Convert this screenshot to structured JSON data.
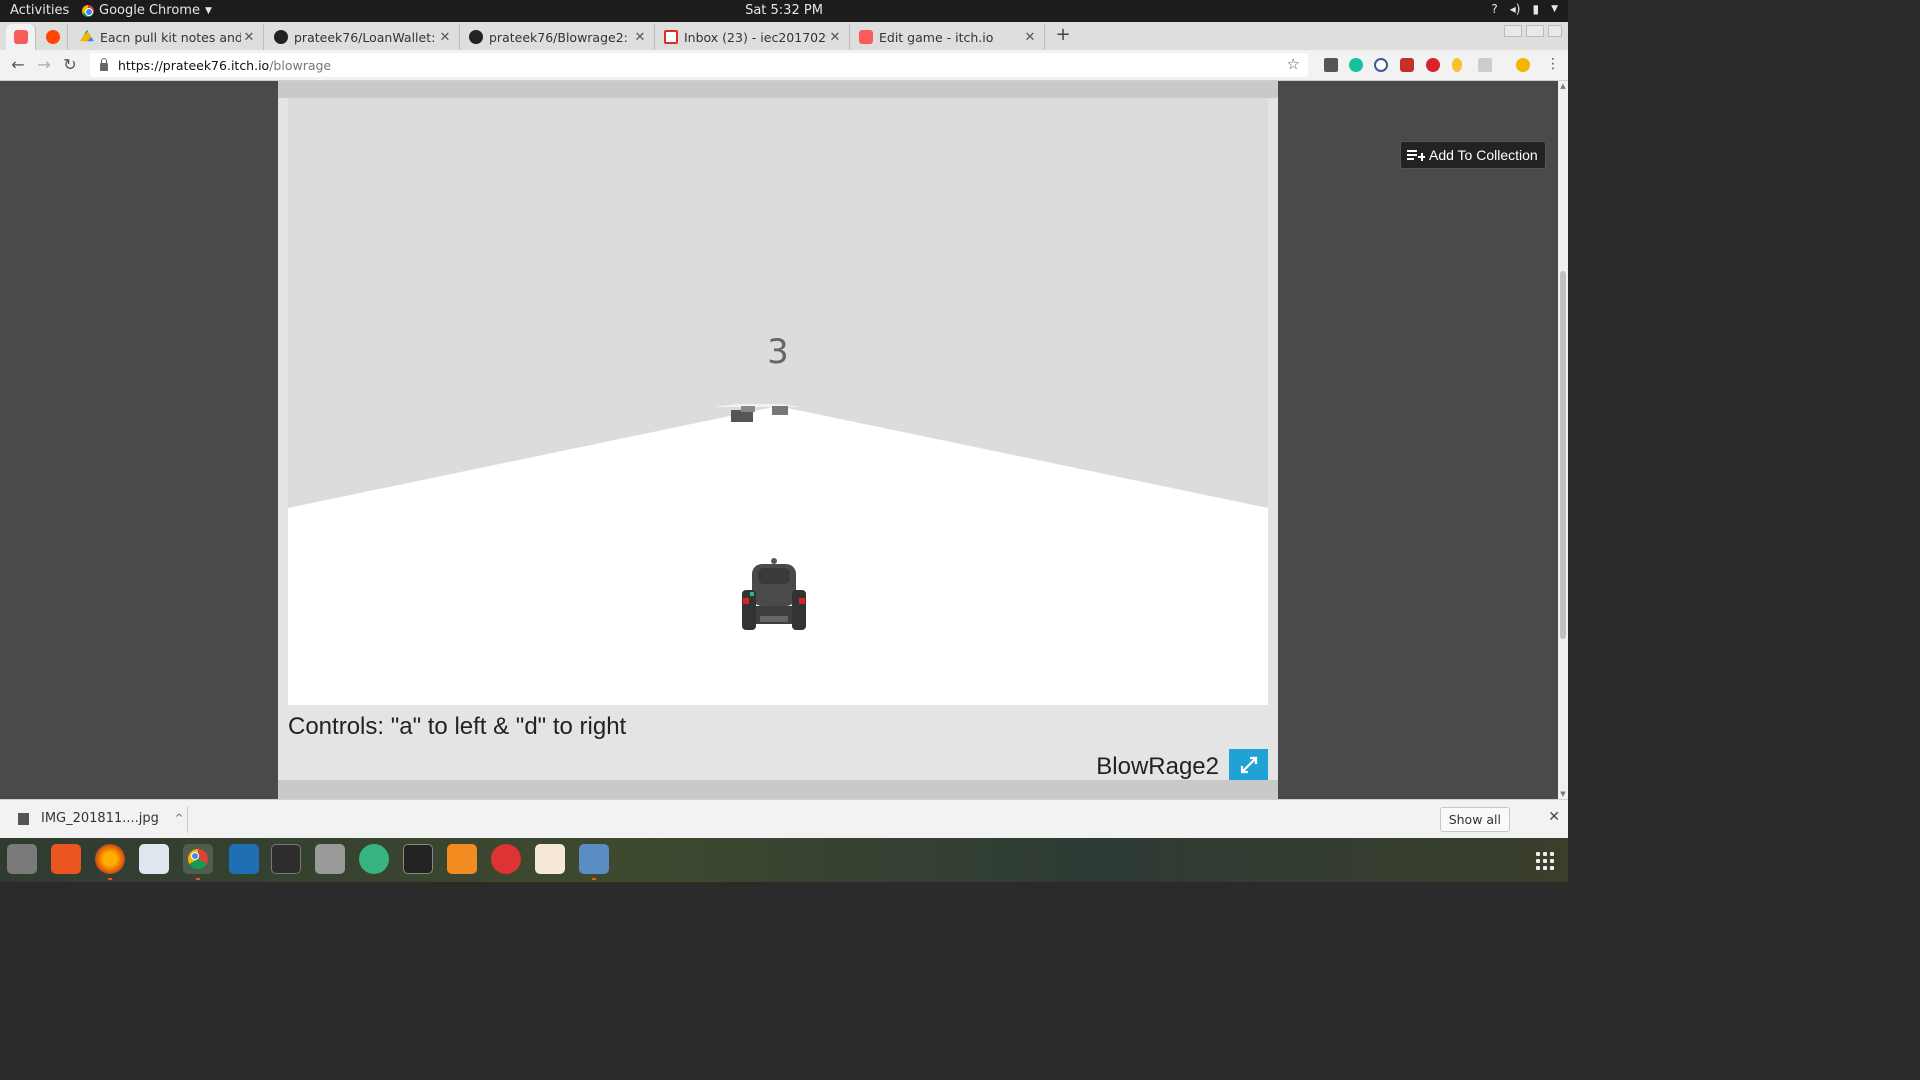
{
  "topbar": {
    "activities": "Activities",
    "app_name": "Google Chrome",
    "clock": "Sat  5:32 PM"
  },
  "tabs": [
    {
      "title": "",
      "favicon": "itch-icon",
      "pinned": true,
      "active": true
    },
    {
      "title": "",
      "favicon": "reddit-icon",
      "pinned": true,
      "active": false
    },
    {
      "title": "Eacn pull kit notes and so",
      "favicon": "google-drive-icon"
    },
    {
      "title": "prateek76/LoanWallet: W",
      "favicon": "github-icon"
    },
    {
      "title": "prateek76/Blowrage2: A",
      "favicon": "github-icon"
    },
    {
      "title": "Inbox (23) - iec2017029@",
      "favicon": "gmail-icon"
    },
    {
      "title": "Edit game - itch.io",
      "favicon": "itch-icon"
    }
  ],
  "address_bar": {
    "url_host": "https://prateek76.itch.io",
    "url_path": "/blowrage"
  },
  "page": {
    "add_to_collection": "Add To Collection",
    "countdown": "3",
    "controls": "Controls: \"a\" to left & \"d\" to right",
    "game_title": "BlowRage2"
  },
  "downloads": {
    "file_name": "IMG_201811....jpg",
    "show_all": "Show all"
  },
  "colors": {
    "accent_fullscreen": "#1fa3d6",
    "game_sky": "#dcdcdc",
    "game_road": "#ffffff"
  }
}
